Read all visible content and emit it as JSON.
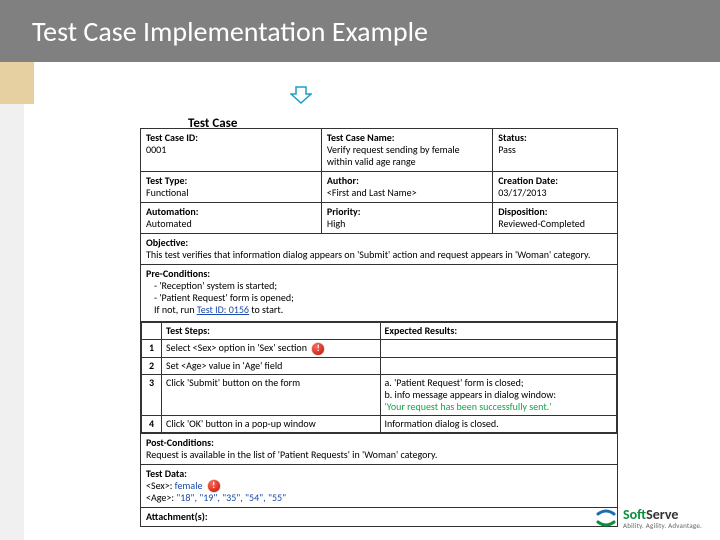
{
  "title": "Test Case Implementation Example",
  "section_label": "Test Case",
  "row1": {
    "id_label": "Test Case ID:",
    "id_value": "0001",
    "name_label": "Test Case Name:",
    "name_value": "Verify request sending by female within valid age range",
    "status_label": "Status:",
    "status_value": "Pass"
  },
  "row2": {
    "type_label": "Test Type:",
    "type_value": "Functional",
    "author_label": "Author:",
    "author_value": "<First and Last Name>",
    "date_label": "Creation Date:",
    "date_value": "03/17/2013"
  },
  "row3": {
    "auto_label": "Automation:",
    "auto_value": "Automated",
    "prio_label": "Priority:",
    "prio_value": "High",
    "disp_label": "Disposition:",
    "disp_value": "Reviewed-Completed"
  },
  "objective": {
    "label": "Objective:",
    "text": "This test verifies that information dialog appears on 'Submit' action and request appears in 'Woman' category."
  },
  "pre": {
    "label": "Pre-Conditions:",
    "l1": "- 'Reception' system is started;",
    "l2": "- 'Patient Request' form is opened;",
    "l3a": "If not, run ",
    "l3link": "Test ID: 0156",
    "l3b": " to start."
  },
  "steps": {
    "h_step": "Test Steps:",
    "h_exp": "Expected Results:",
    "r1": {
      "n": "1",
      "step": "Select <Sex> option in 'Sex' section",
      "exp": ""
    },
    "r2": {
      "n": "2",
      "step": "Set <Age> value in 'Age' field",
      "exp": ""
    },
    "r3": {
      "n": "3",
      "step": "Click 'Submit' button on the form",
      "exp_a": "a. 'Patient Request' form is closed;",
      "exp_b": "b. info message appears in dialog window:",
      "exp_c": "'Your request has been successfully sent.'"
    },
    "r4": {
      "n": "4",
      "step": "Click 'OK' button in a pop-up window",
      "exp": "Information dialog is closed."
    }
  },
  "post": {
    "label": "Post-Conditions:",
    "text": "Request is available in the list of 'Patient Requests' in 'Woman' category."
  },
  "testdata": {
    "label": "Test Data:",
    "sex_key": "<Sex>: ",
    "sex_val": "female",
    "age_key": "<Age>: ",
    "age_val": "\"18\", \"19\", \"35\", \"54\", \"55\""
  },
  "attach": {
    "label": "Attachment(s):"
  },
  "logo": {
    "brand1": "Soft",
    "brand2": "Serve",
    "tag": "Ability. Agility. Advantage."
  }
}
